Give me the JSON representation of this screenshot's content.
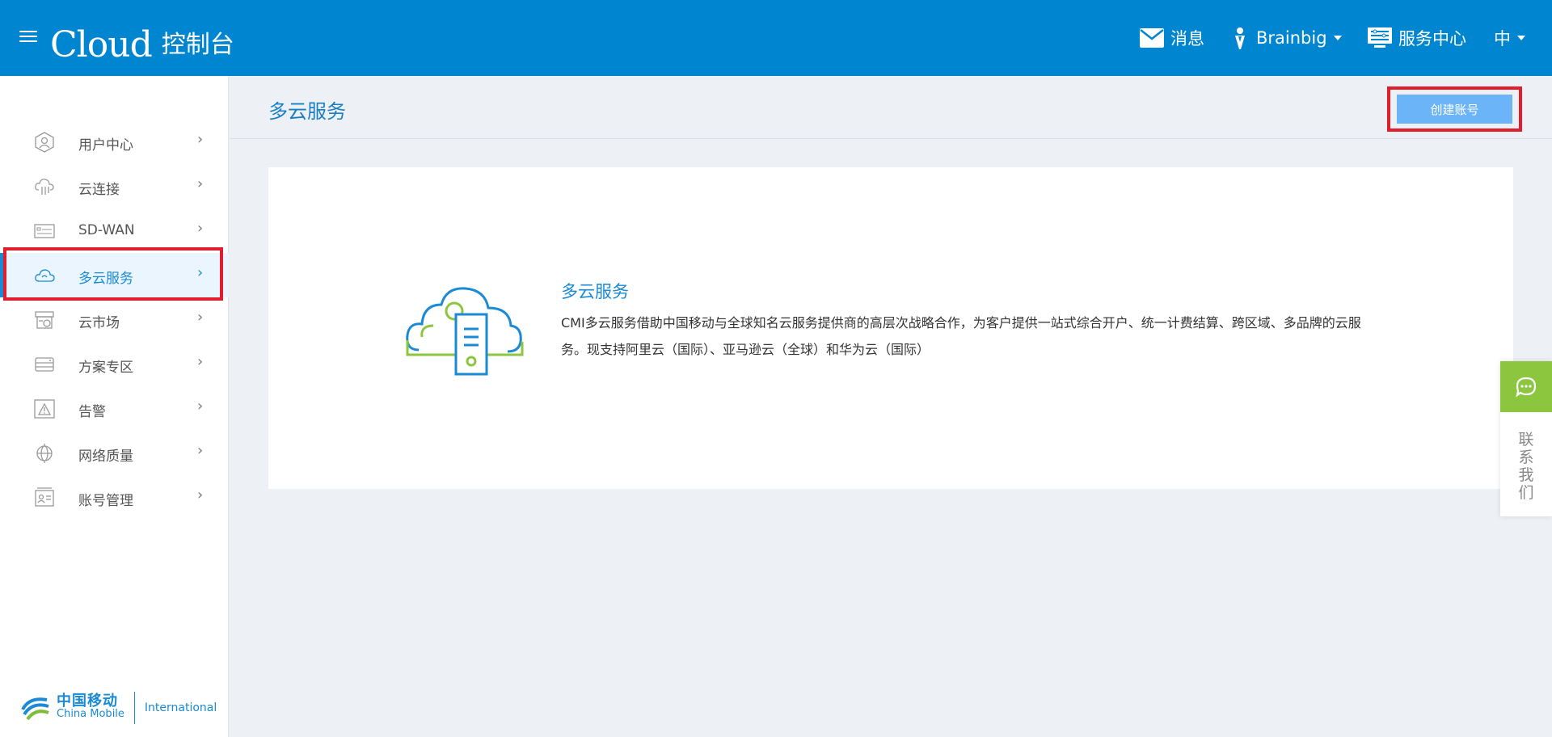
{
  "header": {
    "brand_logo": "Cloud",
    "brand_title": "控制台",
    "messages_label": "消息",
    "user_label": "Brainbig",
    "service_center_label": "服务中心",
    "language_label": "中"
  },
  "sidebar": {
    "items": [
      {
        "label": "用户中心"
      },
      {
        "label": "云连接"
      },
      {
        "label": "SD-WAN"
      },
      {
        "label": "多云服务",
        "active": true
      },
      {
        "label": "云市场"
      },
      {
        "label": "方案专区"
      },
      {
        "label": "告警"
      },
      {
        "label": "网络质量"
      },
      {
        "label": "账号管理"
      }
    ],
    "footer": {
      "cn": "中国移动",
      "en": "China Mobile",
      "intl": "International"
    }
  },
  "page": {
    "title": "多云服务",
    "create_button": "创建账号"
  },
  "card": {
    "title": "多云服务",
    "description": "CMI多云服务借助中国移动与全球知名云服务提供商的高层次战略合作，为客户提供一站式综合开户、统一计费结算、跨区域、多品牌的云服务。现支持阿里云（国际）、亚马逊云（全球）和华为云（国际）"
  },
  "contact": {
    "label": "联系我们"
  },
  "colors": {
    "topbar": "#0086d1",
    "accent": "#1a8ad4",
    "highlight": "#e01e2d",
    "button": "#6bb4f7",
    "contact_green": "#8cc63f"
  }
}
